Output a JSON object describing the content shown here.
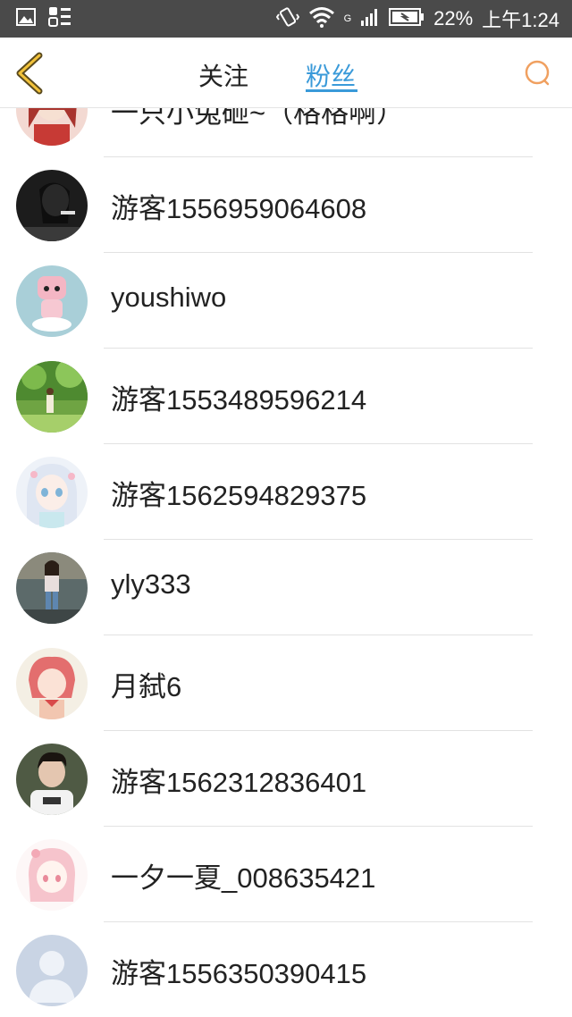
{
  "status_bar": {
    "battery_percent": "22%",
    "time": "上午1:24",
    "network_label": "G"
  },
  "header": {
    "tabs": [
      {
        "label": "关注",
        "active": false
      },
      {
        "label": "粉丝",
        "active": true
      }
    ],
    "accent_color": "#3a9ad9",
    "back_icon": "chevron-left-icon",
    "search_icon": "search-icon"
  },
  "fans": [
    {
      "name": "一只小兔砸~（格格啊）",
      "avatar": "red-haired-anime-girl"
    },
    {
      "name": "游客1556959064608",
      "avatar": "dark-photo-girl"
    },
    {
      "name": "youshiwo",
      "avatar": "pink-plush-toy"
    },
    {
      "name": "游客1553489596214",
      "avatar": "forest-girl"
    },
    {
      "name": "游客1562594829375",
      "avatar": "white-haired-anime-girl"
    },
    {
      "name": "yly333",
      "avatar": "girl-in-jeans"
    },
    {
      "name": "月弑6",
      "avatar": "pink-haired-anime-girl"
    },
    {
      "name": "游客1562312836401",
      "avatar": "boy-white-shirt"
    },
    {
      "name": "一夕一夏_008635421",
      "avatar": "pink-sketch-anime-girl"
    },
    {
      "name": "游客1556350390415",
      "avatar": "default-user-avatar"
    }
  ]
}
